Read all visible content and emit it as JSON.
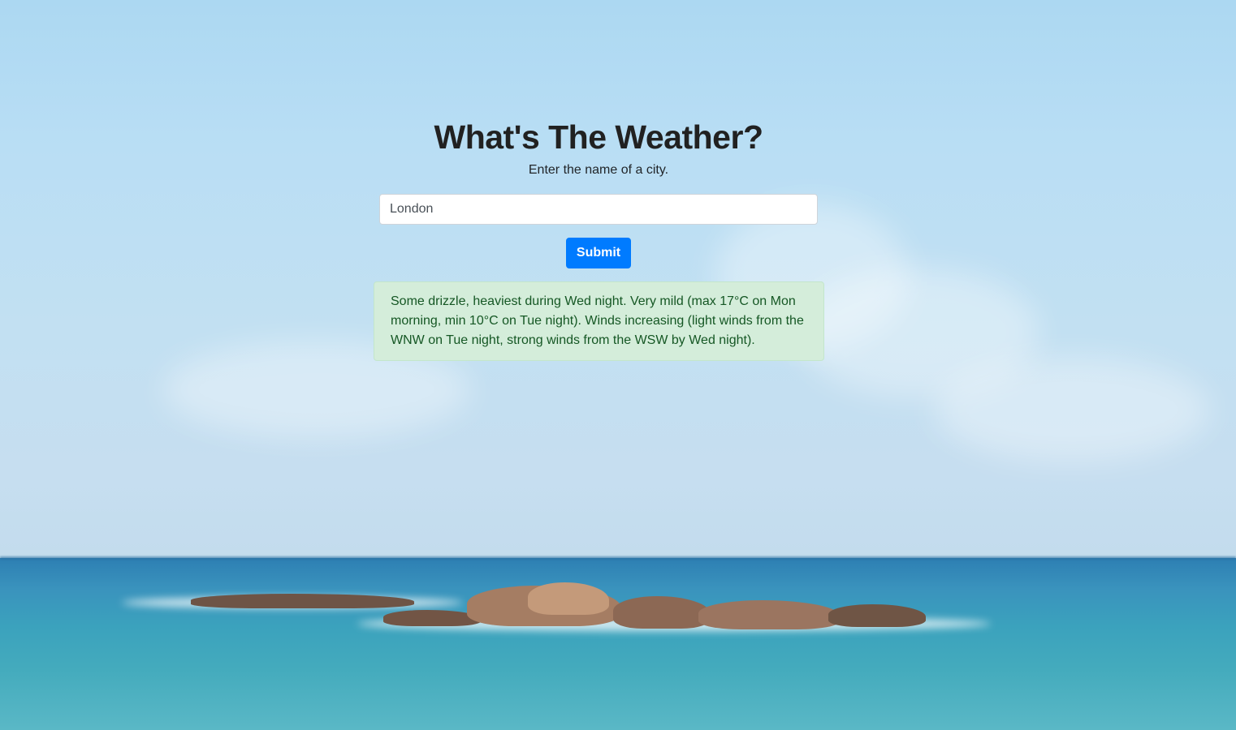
{
  "page": {
    "title": "What's The Weather?",
    "subtitle": "Enter the name of a city."
  },
  "search": {
    "value": "London",
    "submit_label": "Submit"
  },
  "result": {
    "text": "Some drizzle, heaviest during Wed night. Very mild (max 17°C on Mon morning, min 10°C on Tue night). Winds increasing (light winds from the WNW on Tue night, strong winds from the WSW by Wed night)."
  },
  "colors": {
    "accent": "#007bff",
    "alert_background": "#d4edda",
    "alert_text": "#155724"
  }
}
